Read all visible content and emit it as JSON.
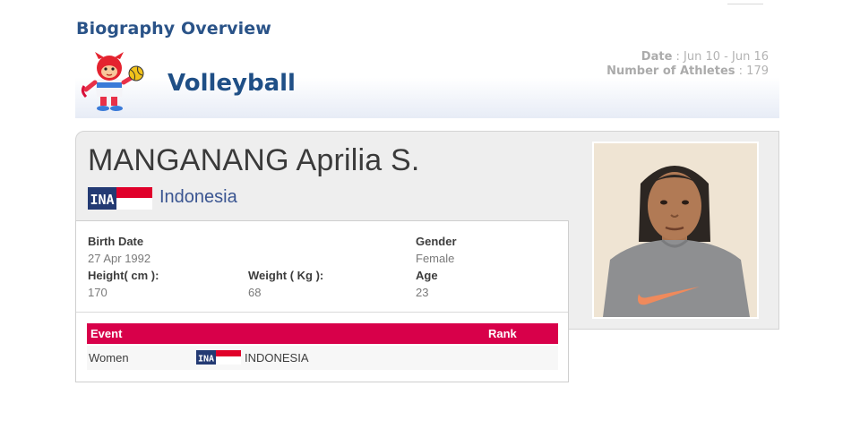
{
  "header": {
    "section_title": "Biography Overview",
    "sport": "Volleyball",
    "date_label": "Date",
    "date_value": ": Jun 10 - Jun 16",
    "athletes_label": "Number of Athletes",
    "athletes_value": ": 179"
  },
  "athlete": {
    "name": "MANGANANG Aprilia S.",
    "country_code": "INA",
    "country": "Indonesia"
  },
  "details": {
    "birth_date_label": "Birth Date",
    "birth_date": "27 Apr 1992",
    "gender_label": "Gender",
    "gender": "Female",
    "height_label": "Height( cm ):",
    "height": "170",
    "weight_label": "Weight ( Kg ):",
    "weight": "68",
    "age_label": "Age",
    "age": "23"
  },
  "events": {
    "headers": {
      "event": "Event",
      "rank": "Rank"
    },
    "rows": [
      {
        "event": "Women",
        "country_code": "INA",
        "team": "INDONESIA",
        "rank": ""
      }
    ]
  },
  "colors": {
    "title_blue": "#2a5388",
    "sport_blue": "#1f4f86",
    "event_header_red": "#d8004a",
    "flag_red": "#e0002a",
    "flag_navy": "#233a73"
  },
  "icons": {
    "mascot": "games-mascot-icon",
    "flag": "indonesia-flag-icon"
  }
}
